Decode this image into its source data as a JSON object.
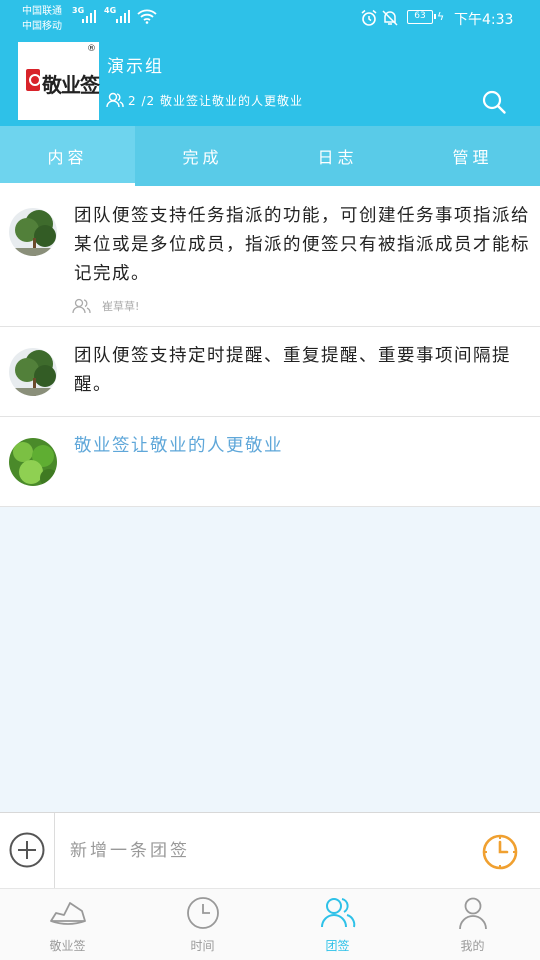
{
  "status_bar": {
    "carrier1": "中国联通",
    "carrier2": "中国移动",
    "net1": "3G",
    "net2": "4G",
    "battery": "63",
    "time": "下午4:33"
  },
  "header": {
    "logo_text": "敬业签",
    "logo_reg": "®",
    "group_name": "演示组",
    "member_info": "2 /2 敬业签让敬业的人更敬业"
  },
  "tabs": [
    {
      "label": "内容",
      "active": true
    },
    {
      "label": "完成",
      "active": false
    },
    {
      "label": "日志",
      "active": false
    },
    {
      "label": "管理",
      "active": false
    }
  ],
  "items": [
    {
      "text": "团队便签支持任务指派的功能，可创建任务事项指派给某位或是多位成员，指派的便签只有被指派成员才能标记完成。",
      "assignee": "崔草草!"
    },
    {
      "text": "团队便签支持定时提醒、重复提醒、重要事项间隔提醒。"
    },
    {
      "text": "敬业签让敬业的人更敬业"
    }
  ],
  "input": {
    "placeholder": "新增一条团签"
  },
  "bottom_nav": [
    {
      "label": "敬业签",
      "icon": "notes-boat-icon",
      "active": false
    },
    {
      "label": "时间",
      "icon": "clock-icon",
      "active": false
    },
    {
      "label": "团签",
      "icon": "team-icon",
      "active": true
    },
    {
      "label": "我的",
      "icon": "person-icon",
      "active": false
    }
  ],
  "colors": {
    "primary": "#2ec1e8",
    "tabs_bg": "#59cbe8",
    "link_text": "#5fa7d9",
    "reminder": "#f0a030"
  }
}
